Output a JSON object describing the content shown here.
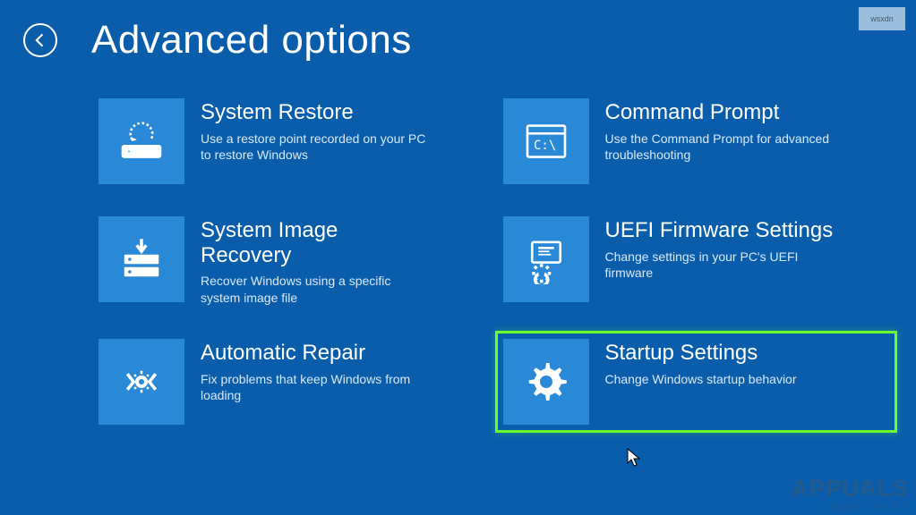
{
  "page": {
    "title": "Advanced options"
  },
  "options": [
    {
      "id": "system-restore",
      "title": "System Restore",
      "desc": "Use a restore point recorded on your PC to restore Windows",
      "icon": "restore-icon"
    },
    {
      "id": "command-prompt",
      "title": "Command Prompt",
      "desc": "Use the Command Prompt for advanced troubleshooting",
      "icon": "terminal-icon"
    },
    {
      "id": "system-image-recovery",
      "title": "System Image Recovery",
      "desc": "Recover Windows using a specific system image file",
      "icon": "image-recovery-icon"
    },
    {
      "id": "uefi-firmware",
      "title": "UEFI Firmware Settings",
      "desc": "Change settings in your PC's UEFI firmware",
      "icon": "firmware-icon"
    },
    {
      "id": "automatic-repair",
      "title": "Automatic Repair",
      "desc": "Fix problems that keep Windows from loading",
      "icon": "repair-icon"
    },
    {
      "id": "startup-settings",
      "title": "Startup Settings",
      "desc": "Change Windows startup behavior",
      "icon": "gear-icon",
      "highlighted": true
    }
  ],
  "watermark": {
    "main": "APPUALS",
    "sub": "FROM THE EX",
    "box": "wsxdn"
  }
}
